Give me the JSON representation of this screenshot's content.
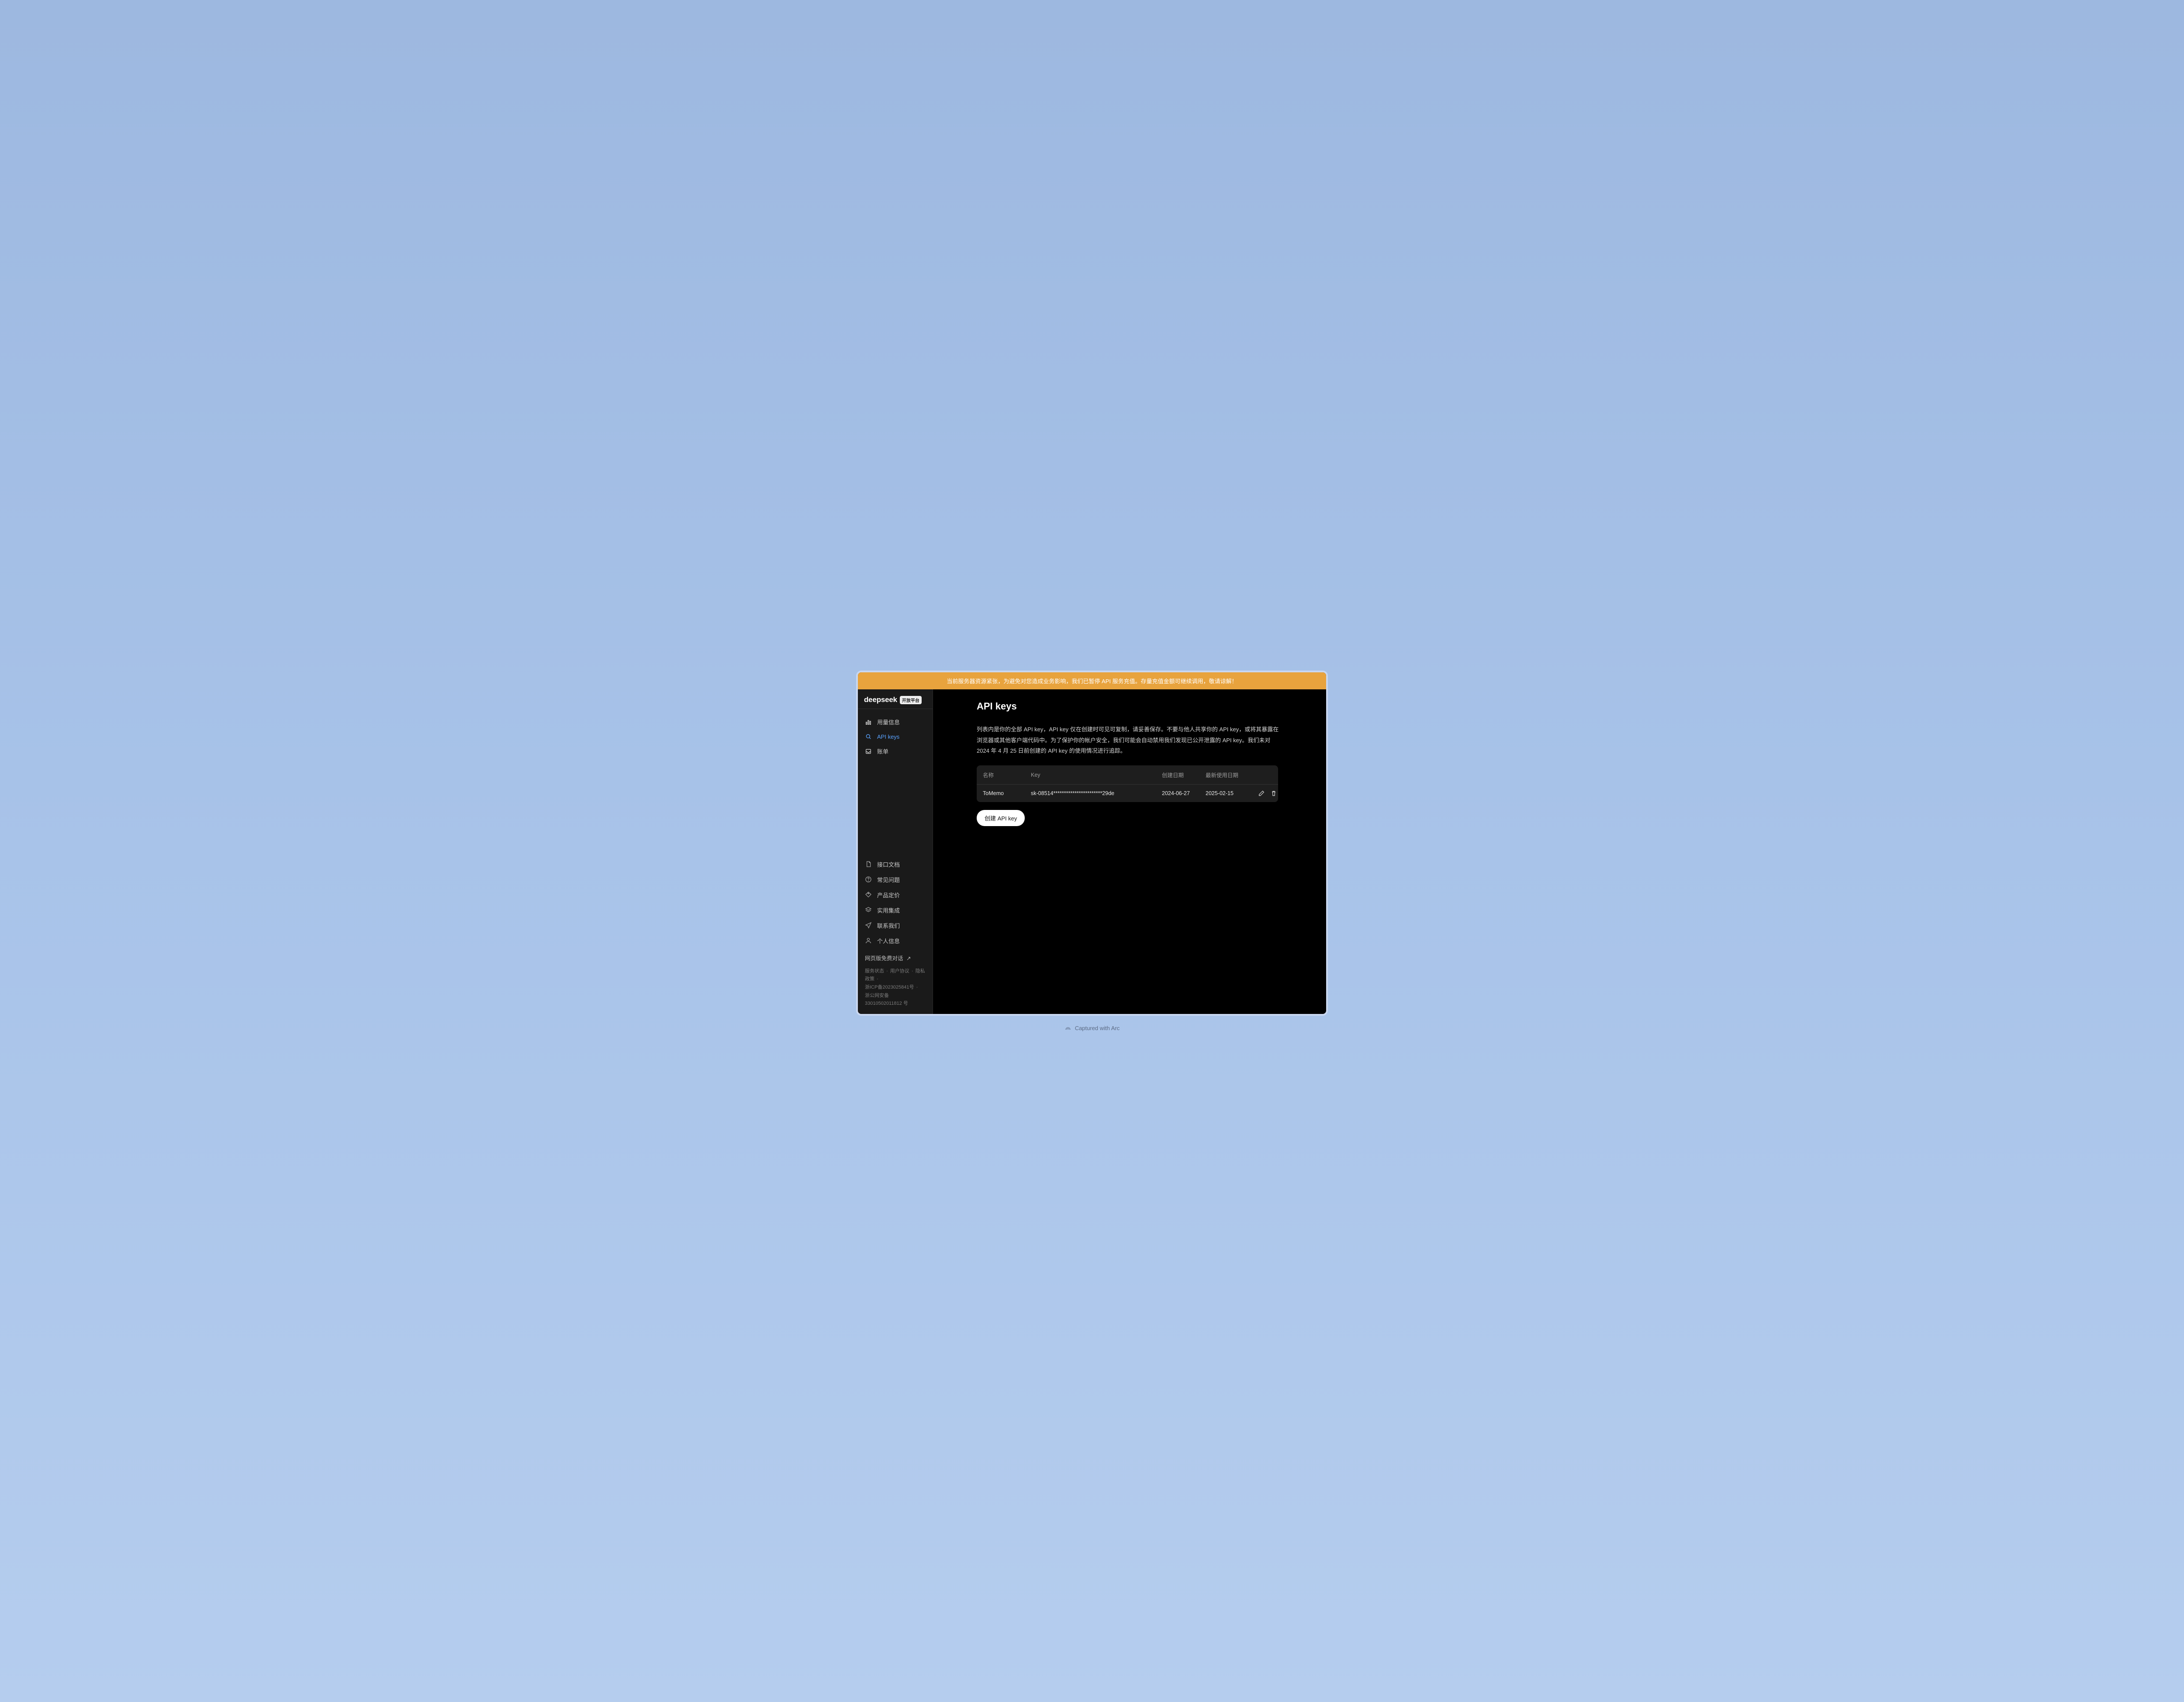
{
  "banner": {
    "text": "当前服务器资源紧张，为避免对您造成业务影响，我们已暂停 API 服务充值。存量充值金额可继续调用，敬请谅解！"
  },
  "brand": {
    "name": "deepseek",
    "badge": "开放平台"
  },
  "sidebar": {
    "primary": [
      {
        "label": "用量信息",
        "icon": "usage"
      },
      {
        "label": "API keys",
        "icon": "search",
        "active": true
      },
      {
        "label": "账单",
        "icon": "billing"
      }
    ],
    "secondary": [
      {
        "label": "接口文档",
        "icon": "doc"
      },
      {
        "label": "常见问题",
        "icon": "help"
      },
      {
        "label": "产品定价",
        "icon": "pricing"
      },
      {
        "label": "实用集成",
        "icon": "integration"
      },
      {
        "label": "联系我们",
        "icon": "contact"
      },
      {
        "label": "个人信息",
        "icon": "profile"
      }
    ],
    "chat_link": "网页版免费对话",
    "footer": {
      "items": [
        "服务状态",
        "用户协议",
        "隐私政策"
      ],
      "icp": "浙ICP备2023025841号",
      "police": "浙公网安备 33010502011812 号"
    }
  },
  "page": {
    "title": "API keys",
    "description": "列表内是你的全部 API key，API key 仅在创建时可见可复制，请妥善保存。不要与他人共享你的 API key，或将其暴露在浏览器或其他客户端代码中。为了保护你的帐户安全，我们可能会自动禁用我们发现已公开泄露的 API key。我们未对 2024 年 4 月 25 日前创建的 API key 的使用情况进行追踪。",
    "table": {
      "headers": {
        "name": "名称",
        "key": "Key",
        "created": "创建日期",
        "last_used": "最新使用日期"
      },
      "rows": [
        {
          "name": "ToMemo",
          "key": "sk-08514***********************29de",
          "created": "2024-06-27",
          "last_used": "2025-02-15"
        }
      ]
    },
    "create_button": "创建 API key"
  },
  "capture": {
    "text": "Captured with Arc"
  }
}
